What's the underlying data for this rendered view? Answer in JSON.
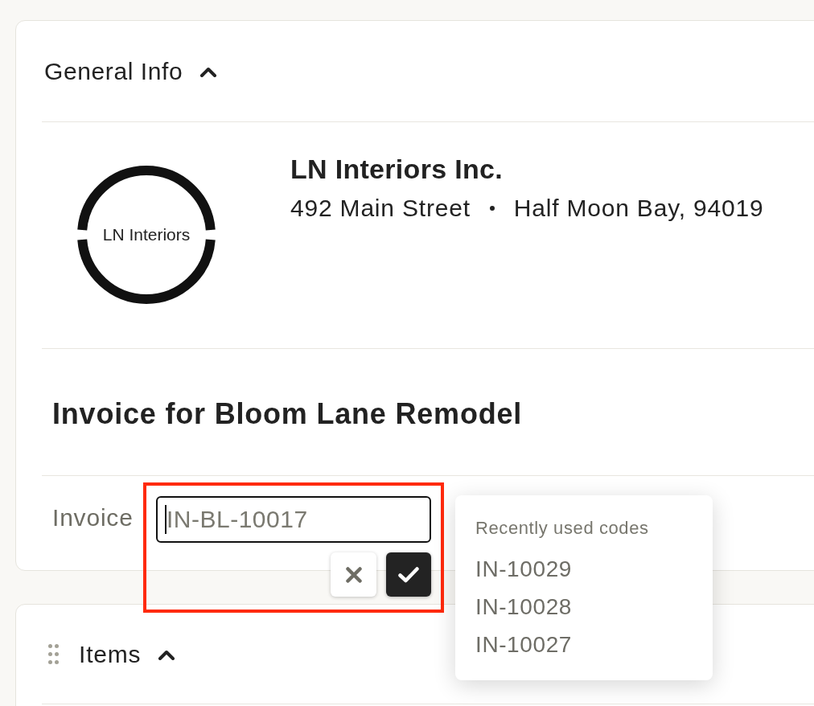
{
  "general_info": {
    "title": "General Info",
    "expanded": true,
    "company": {
      "logo_text": "LN Interiors",
      "name": "LN Interiors Inc.",
      "address": [
        "492 Main Street",
        "Half Moon Bay, 94019"
      ]
    },
    "invoice_title": "Invoice for Bloom Lane Remodel",
    "invoice_field": {
      "label": "Invoice",
      "value": "IN-BL-10017",
      "focused": true,
      "highlighted": true,
      "actions": [
        {
          "kind": "cancel"
        },
        {
          "kind": "confirm"
        }
      ]
    }
  },
  "suggestions": {
    "title": "Recently used codes",
    "items": [
      "IN-10029",
      "IN-10028",
      "IN-10027"
    ]
  },
  "items_section": {
    "title": "Items",
    "expanded": true,
    "draggable": true
  }
}
